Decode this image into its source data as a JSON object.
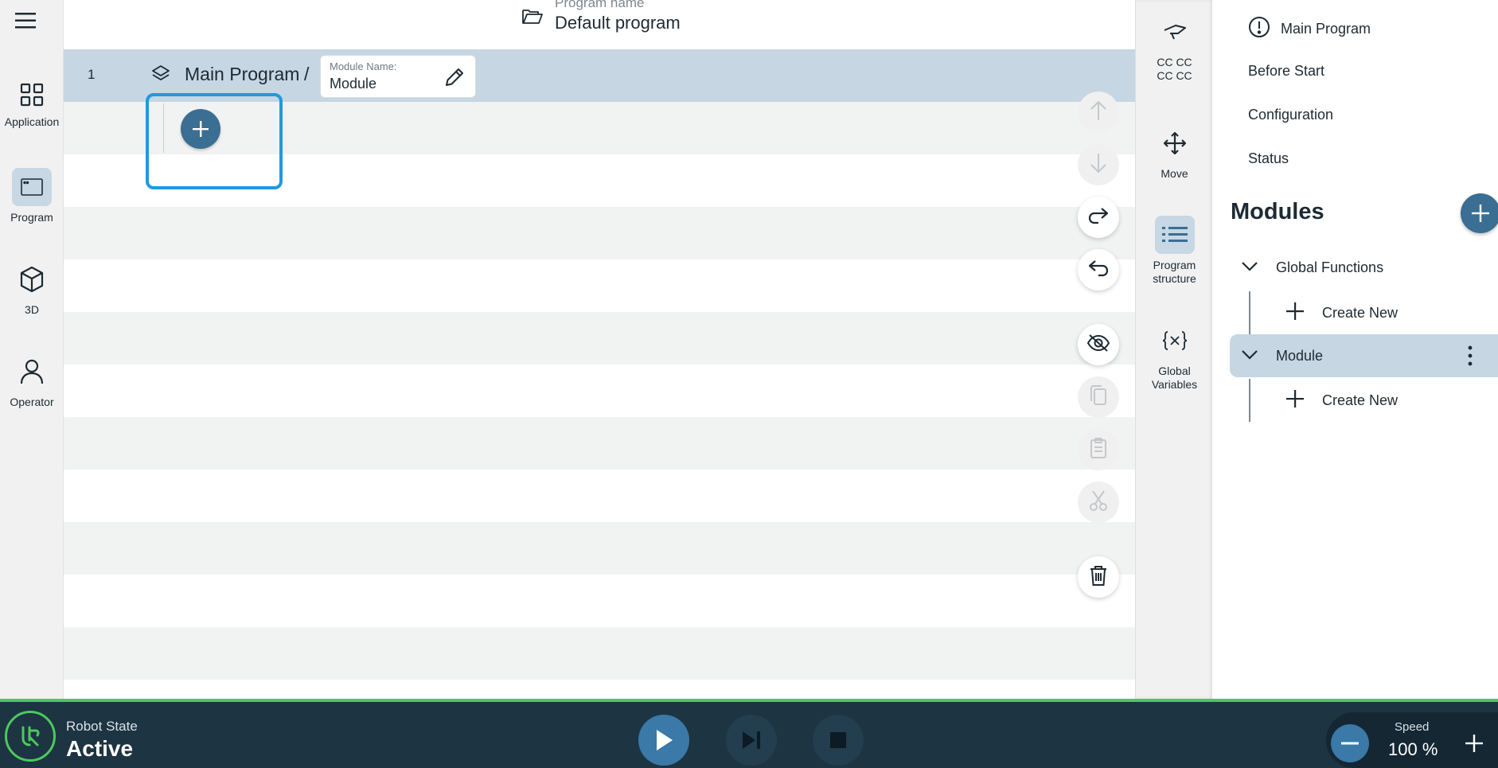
{
  "nav": {
    "items": [
      {
        "label": "Application",
        "icon": "grid-icon"
      },
      {
        "label": "Program",
        "icon": "window-icon",
        "active": true
      },
      {
        "label": "3D",
        "icon": "cube-icon"
      },
      {
        "label": "Operator",
        "icon": "person-icon"
      }
    ]
  },
  "header": {
    "program_name_label": "Program name",
    "program_name": "Default program"
  },
  "program": {
    "line_number": "1",
    "breadcrumb_main": "Main Program",
    "breadcrumb_sep": "/",
    "module_name_label": "Module Name:",
    "module_name_value": "Module"
  },
  "tools": [
    "move-up-icon",
    "move-down-icon",
    "redo-icon",
    "undo-icon",
    "hide-icon",
    "copy-icon",
    "paste-icon",
    "cut-icon",
    "delete-icon"
  ],
  "mid_panel": {
    "items": [
      {
        "label": "CC CC\nCC CC",
        "icon": "tool-icon"
      },
      {
        "label": "Move",
        "icon": "move-arrows-icon"
      },
      {
        "label": "Program\nstructure",
        "icon": "list-icon",
        "active": true
      },
      {
        "label": "Global\nVariables",
        "icon": "variable-icon"
      }
    ]
  },
  "right_panel": {
    "main_program": "Main Program",
    "before_start": "Before Start",
    "configuration": "Configuration",
    "status": "Status",
    "modules_title": "Modules",
    "tree": [
      {
        "label": "Global Functions",
        "create_label": "Create New"
      },
      {
        "label": "Module",
        "create_label": "Create New",
        "selected": true
      }
    ]
  },
  "bottom": {
    "robot_state_label": "Robot State",
    "robot_state_value": "Active",
    "speed_label": "Speed",
    "speed_value": "100 %"
  },
  "colors": {
    "accent": "#3a6e92",
    "highlight": "#1f9ae0",
    "selected_row": "#c6d6e2",
    "bottom_bar": "#1d3442",
    "status_green": "#4cc85e"
  }
}
